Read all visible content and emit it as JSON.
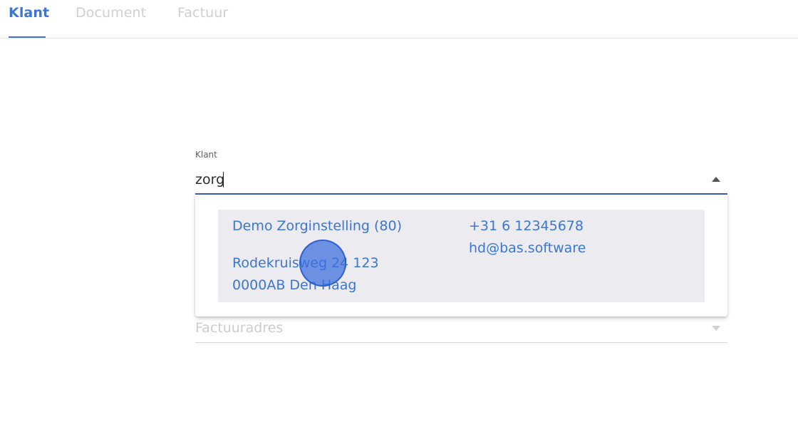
{
  "tabs": [
    {
      "label": "Klant",
      "active": true
    },
    {
      "label": "Document",
      "active": false
    },
    {
      "label": "Factuur",
      "active": false
    }
  ],
  "klant_field": {
    "label": "Klant",
    "value": "zorg"
  },
  "dropdown": {
    "options": [
      {
        "name": "Demo Zorginstelling (80)",
        "phone": "+31 6 12345678",
        "email": "hd@bas.software",
        "street": "Rodekruisweg 24 123",
        "city": "0000AB Den Haag"
      }
    ]
  },
  "factuuradres_field": {
    "placeholder": "Factuuradres"
  },
  "colors": {
    "accent": "#3b76d3",
    "underline_active": "#3a5bbf",
    "option_bg": "#ebebf0",
    "inactive_text": "#cfcfcf"
  },
  "icons": [
    "dropdown-arrow-up-icon",
    "dropdown-arrow-down-icon"
  ]
}
